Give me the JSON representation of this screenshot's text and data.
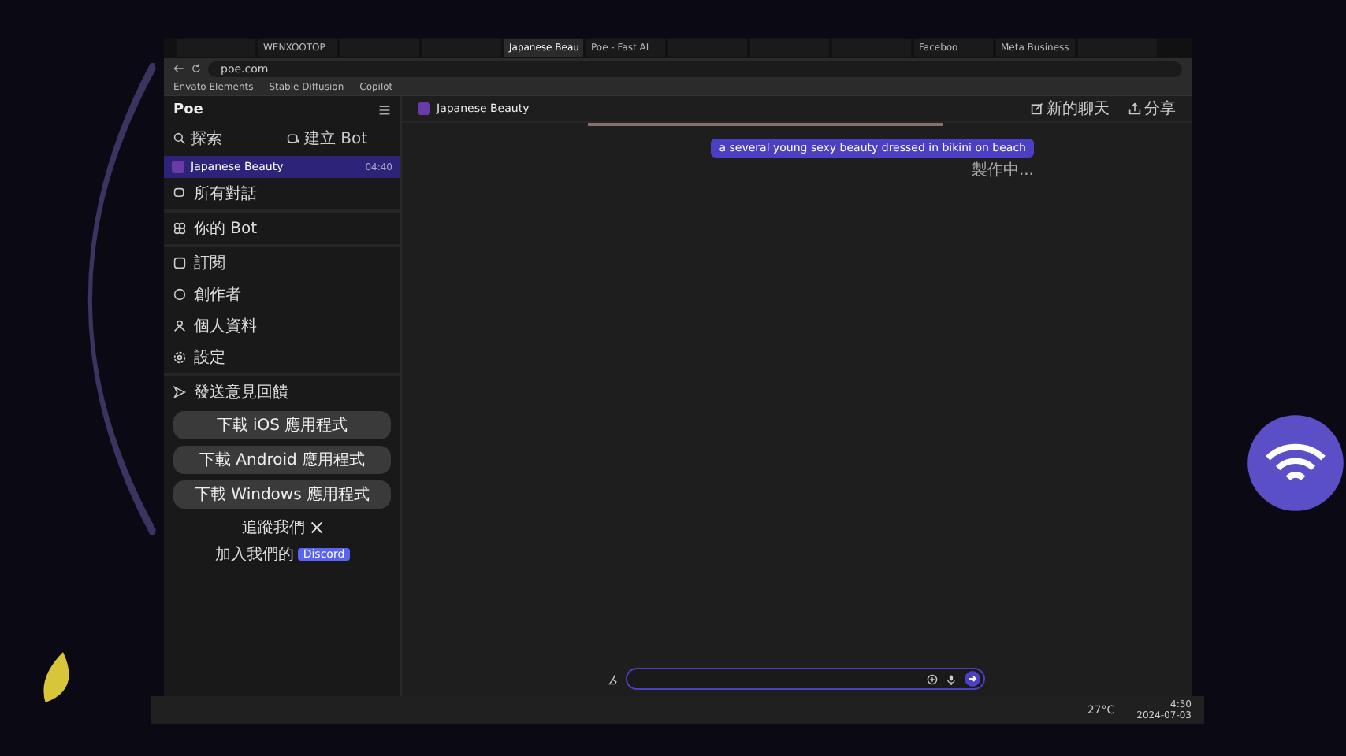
{
  "browser": {
    "tabs": [
      {
        "selected": false
      },
      {
        "title": "WENXOOTOP",
        "selected": false
      },
      {
        "selected": false
      },
      {
        "selected": false
      },
      {
        "title": "Japanese Beau",
        "selected": true
      },
      {
        "title": "Poe - Fast AI",
        "selected": false
      },
      {
        "selected": false
      },
      {
        "selected": false
      },
      {
        "selected": false
      },
      {
        "title": "Faceboo",
        "selected": false
      },
      {
        "title": "Meta Business",
        "selected": false
      },
      {
        "selected": false
      }
    ],
    "address": "poe.com",
    "bookmarks": [
      "Envato Elements",
      "Stable Diffusion",
      "Copilot"
    ]
  },
  "sidebar": {
    "logo": "Poe",
    "quick": [
      {
        "label": "探索",
        "kind": "search"
      },
      {
        "label": "建立 Bot",
        "kind": "create"
      }
    ],
    "active_chat": {
      "time": "04:40",
      "name": "Japanese Beauty",
      "selected": true
    },
    "items": [
      {
        "label": "所有對話",
        "kind": "chats"
      },
      {
        "label": "你的 Bot",
        "kind": "bots"
      },
      {
        "label": "訂閱",
        "kind": "subscribe"
      },
      {
        "label": "創作者",
        "kind": "creators"
      },
      {
        "label": "個人資料",
        "kind": "profile"
      },
      {
        "label": "設定",
        "kind": "settings"
      },
      {
        "label": "發送意見回饋",
        "kind": "feedback"
      }
    ],
    "downloads": [
      "下載 iOS 應用程式",
      "下載 Android 應用程式",
      "下載 Windows 應用程式"
    ],
    "follow": "追蹤我們",
    "join": "加入我們的",
    "discord": "Discord"
  },
  "chat": {
    "title": "Japanese Beauty",
    "actions": [
      {
        "label": "新的聊天",
        "kind": "new"
      },
      {
        "label": "分享",
        "kind": "share"
      }
    ],
    "messages": [
      {
        "text": "a several young sexy beauty dressed in bikini on beach",
        "status": "製作中..."
      }
    ]
  },
  "taskbar": {
    "temp": "27°C",
    "time": "4:50",
    "date": "2024-07-03"
  }
}
